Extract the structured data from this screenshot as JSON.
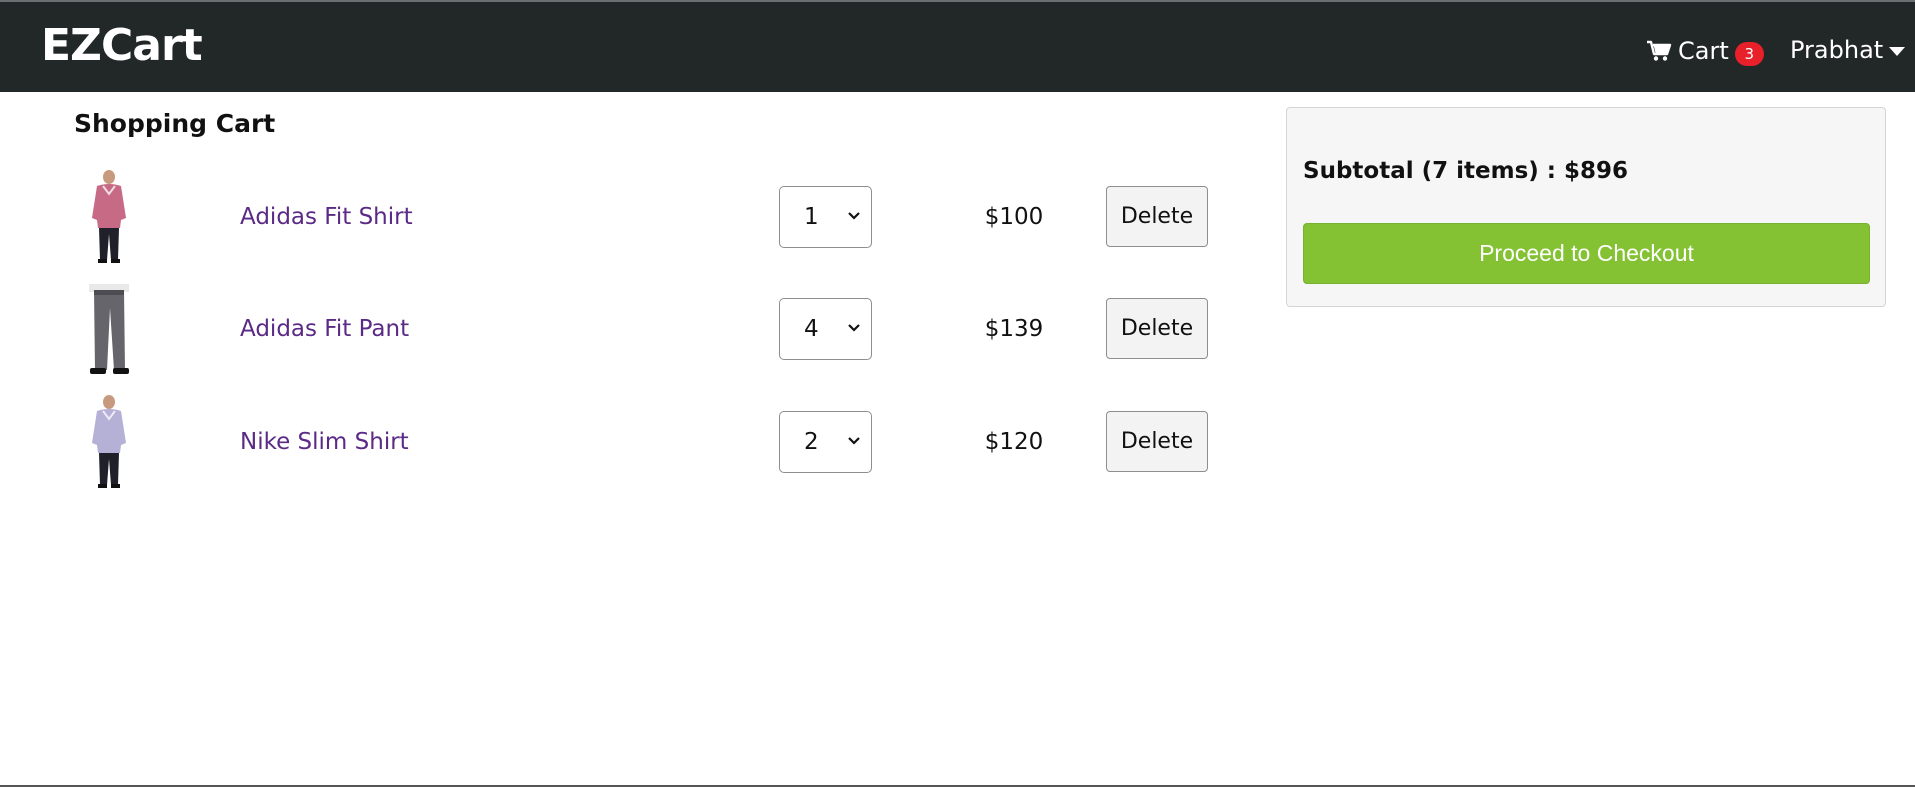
{
  "navbar": {
    "brand": "EZCart",
    "cart_label": "Cart",
    "cart_count": "3",
    "user_name": "Prabhat"
  },
  "page": {
    "title": "Shopping Cart"
  },
  "cart_items": [
    {
      "name": "Adidas Fit Shirt",
      "quantity": "1",
      "price": "$100",
      "delete_label": "Delete",
      "image": "shirt-pink-model"
    },
    {
      "name": "Adidas Fit Pant",
      "quantity": "4",
      "price": "$139",
      "delete_label": "Delete",
      "image": "grey-pants"
    },
    {
      "name": "Nike Slim Shirt",
      "quantity": "2",
      "price": "$120",
      "delete_label": "Delete",
      "image": "shirt-lavender-model"
    }
  ],
  "summary": {
    "subtotal_text": "Subtotal (7 items) : $896",
    "checkout_label": "Proceed to Checkout"
  },
  "colors": {
    "navbar_bg": "#222728",
    "badge_bg": "#e8202a",
    "product_link": "#5a2a86",
    "checkout_bg": "#84c234"
  }
}
